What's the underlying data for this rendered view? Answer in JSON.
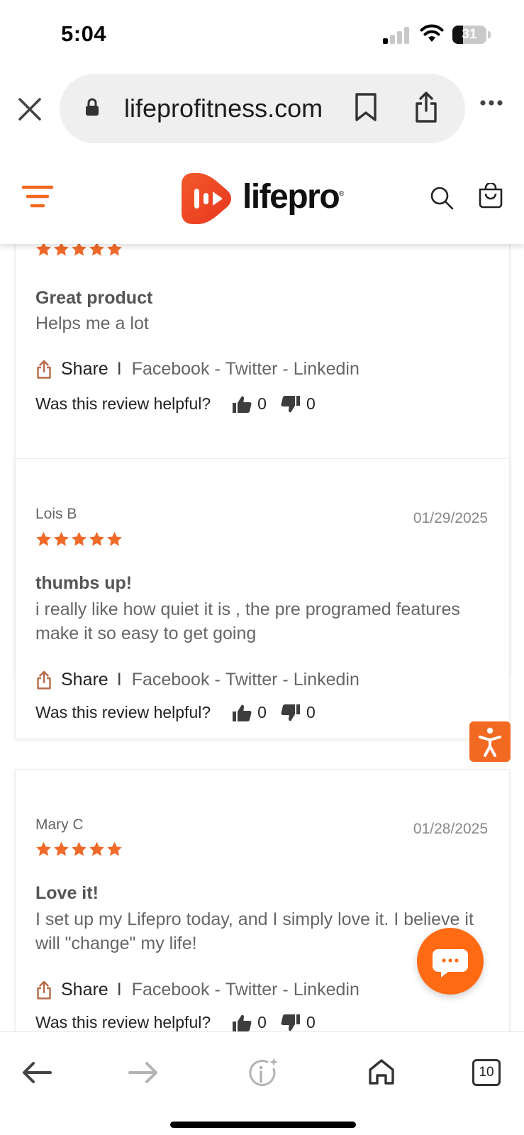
{
  "status_bar": {
    "time": "5:04",
    "battery": "31",
    "battery_level": 0.31
  },
  "browser": {
    "url": "lifeprofitness.com",
    "open_tabs": "10"
  },
  "site": {
    "logo_text": "lifepro",
    "logo_mark": "®"
  },
  "colors": {
    "brand_orange": "#f26a22",
    "star_orange": "#f06a2a",
    "share_brown": "#b86a4a"
  },
  "share": {
    "label": "Share",
    "separator": "I",
    "links": [
      "Facebook",
      "Twitter",
      "Linkedin"
    ],
    "dash": "-"
  },
  "helpful_prompt": "Was this review helpful?",
  "reviews": [
    {
      "rating": 5,
      "title": "Great product",
      "body": "Helps me a lot",
      "helpful_yes": "0",
      "helpful_no": "0"
    },
    {
      "name": "Lois B",
      "date": "01/29/2025",
      "rating": 5,
      "title": "thumbs up!",
      "body": "i really like how quiet it is , the pre programed features make it so easy to get going",
      "helpful_yes": "0",
      "helpful_no": "0"
    },
    {
      "name": "Mary C",
      "date": "01/28/2025",
      "rating": 5,
      "title": "Love it!",
      "body": "I set up my Lifepro today, and I simply love it. I believe it will \"change\" my life!",
      "helpful_yes": "0",
      "helpful_no": "0"
    }
  ],
  "icons": {
    "close": "close-icon",
    "lock": "lock-icon",
    "bookmark": "bookmark-icon",
    "share": "share-icon",
    "more": "more-icon",
    "menu": "menu-icon",
    "search": "search-icon",
    "cart": "cart-icon",
    "accessibility": "accessibility-icon",
    "chat": "chat-icon",
    "back": "back-icon",
    "forward": "forward-icon",
    "info": "info-icon",
    "home": "home-icon"
  }
}
